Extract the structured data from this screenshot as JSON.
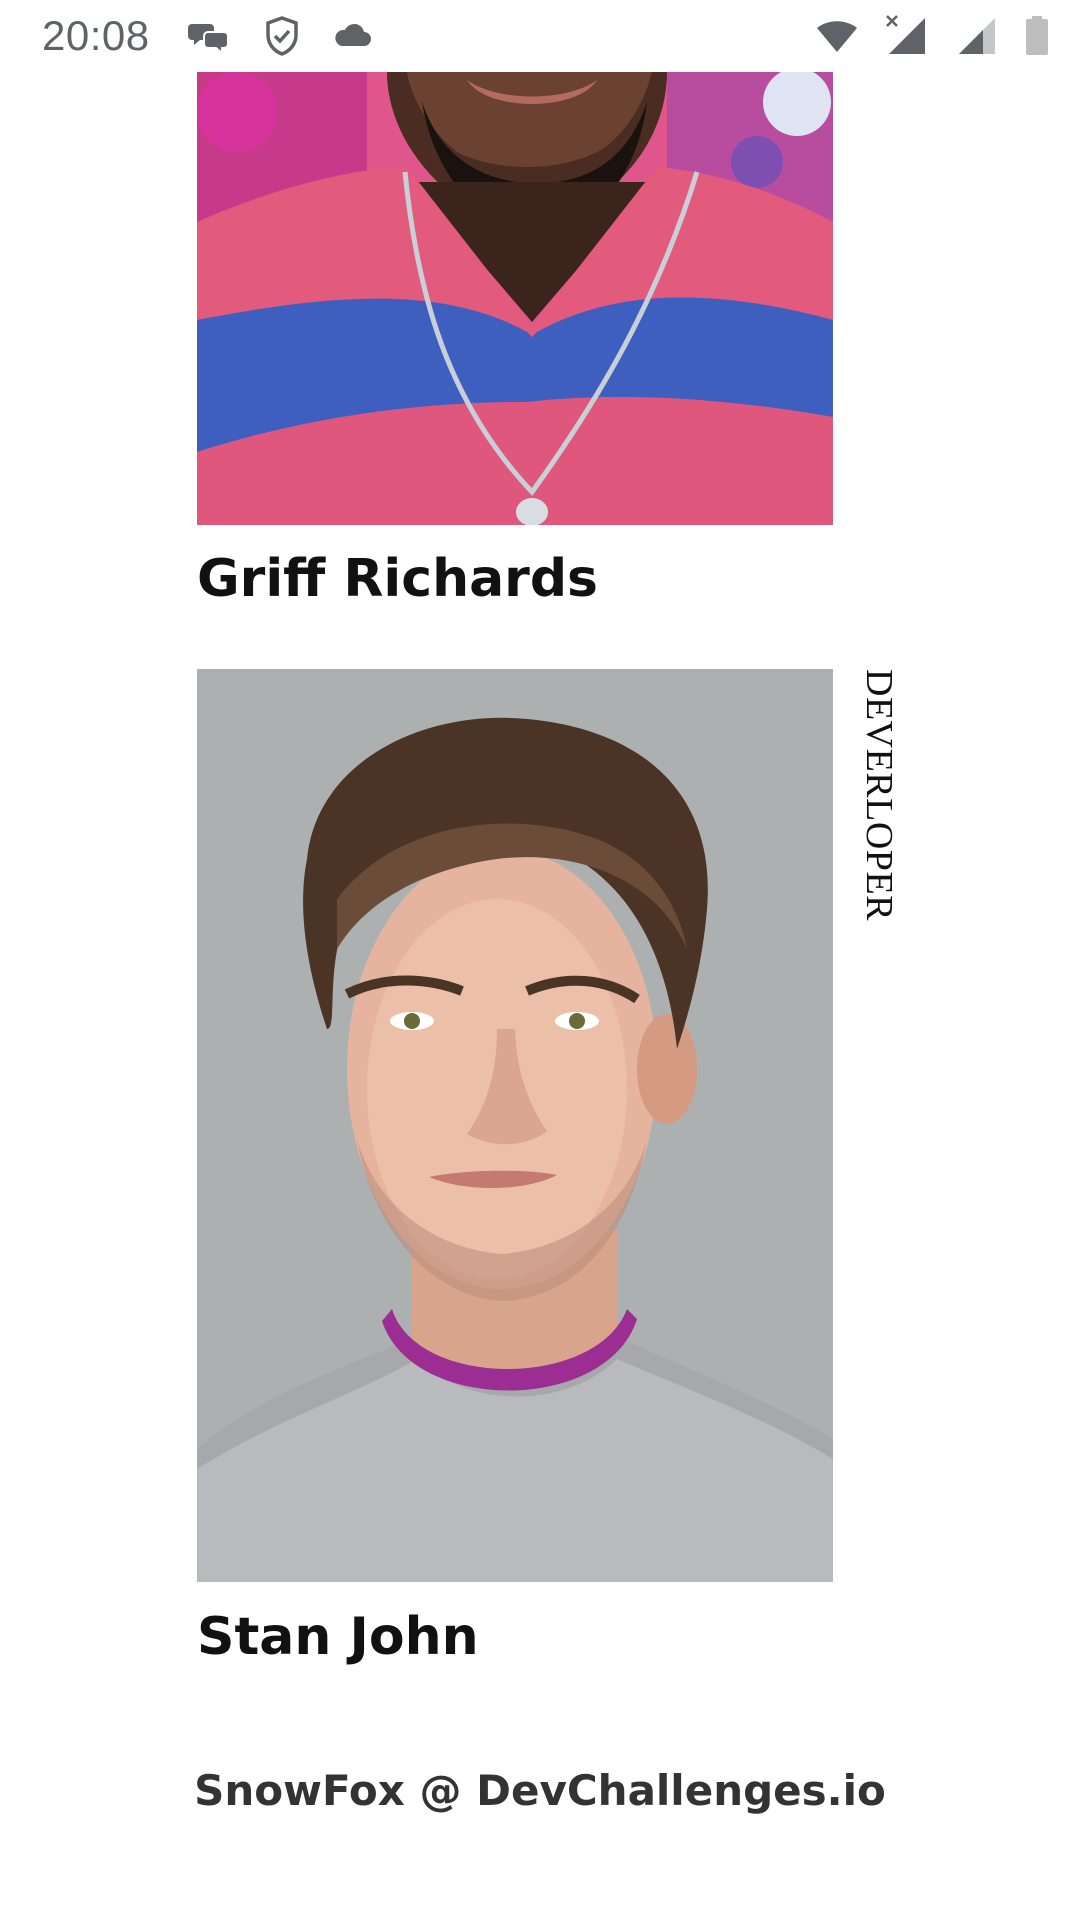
{
  "status_bar": {
    "time": "20:08",
    "left_icons": [
      "messaging-icon",
      "shield-check-icon",
      "cloud-icon"
    ],
    "right_icons": [
      "wifi-icon",
      "mobile-signal-off-icon",
      "cell-signal-icon",
      "battery-icon"
    ]
  },
  "team": {
    "members": [
      {
        "name": "Griff Richards"
      },
      {
        "name": "Stan John",
        "role": "DEVERLOPER"
      }
    ]
  },
  "footer": {
    "credit": "SnowFox @ DevChallenges.io"
  },
  "colors": {
    "text": "#111111",
    "status_icon": "#5f6368",
    "background": "#ffffff"
  }
}
